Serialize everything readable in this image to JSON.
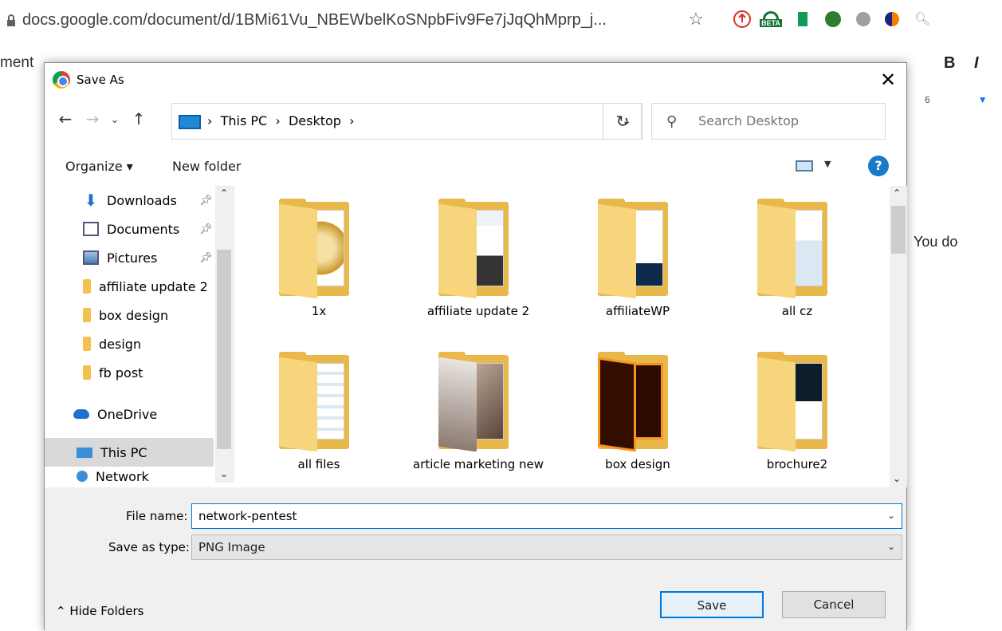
{
  "browser": {
    "url": "docs.google.com/document/d/1BMi61Vu_NBEWbelKoSNpbFiv9Fe7jJqQhMprp_j...",
    "star_icon": "star-icon",
    "extensions": [
      "upload-ext-icon",
      "beta-ext-icon",
      "sheets-ext-icon",
      "globe-ext-icon",
      "ghostery-ext-icon",
      "similarweb-ext-icon",
      "zoom-ext-icon"
    ],
    "beta_badge": "BETA"
  },
  "doc": {
    "menu_fragment": "ment",
    "bold": "B",
    "italic": "I",
    "ruler_mark": "6",
    "body_text": "You do"
  },
  "dialog": {
    "title": "Save As",
    "address": {
      "segments": [
        "This PC",
        "Desktop"
      ],
      "sep": "›"
    },
    "search_placeholder": "Search Desktop",
    "toolbar": {
      "organize": "Organize ▾",
      "new_folder": "New folder",
      "help": "?"
    },
    "nav_items": [
      {
        "label": "Downloads",
        "icon": "download-icon",
        "pinned": true
      },
      {
        "label": "Documents",
        "icon": "documents-icon",
        "pinned": true
      },
      {
        "label": "Pictures",
        "icon": "pictures-icon",
        "pinned": true
      },
      {
        "label": "affiliate update 2",
        "icon": "folder-icon",
        "pinned": false
      },
      {
        "label": "box design",
        "icon": "folder-icon",
        "pinned": false
      },
      {
        "label": "design",
        "icon": "folder-icon",
        "pinned": false
      },
      {
        "label": "fb post",
        "icon": "folder-icon",
        "pinned": false
      },
      {
        "label": "OneDrive",
        "icon": "onedrive-icon",
        "pinned": false
      },
      {
        "label": "This PC",
        "icon": "this-pc-icon",
        "pinned": false,
        "selected": true
      },
      {
        "label": "Network",
        "icon": "network-icon",
        "pinned": false
      }
    ],
    "folders": [
      {
        "label": "1x"
      },
      {
        "label": "affiliate update 2"
      },
      {
        "label": "affiliateWP"
      },
      {
        "label": "all cz"
      },
      {
        "label": "all files"
      },
      {
        "label": "article marketing new"
      },
      {
        "label": "box design"
      },
      {
        "label": "brochure2"
      }
    ],
    "file_name_label": "File name:",
    "file_name_value": "network-pentest",
    "save_type_label": "Save as type:",
    "save_type_value": "PNG Image",
    "hide_folders": "⌃ Hide Folders",
    "save": "Save",
    "cancel": "Cancel"
  }
}
